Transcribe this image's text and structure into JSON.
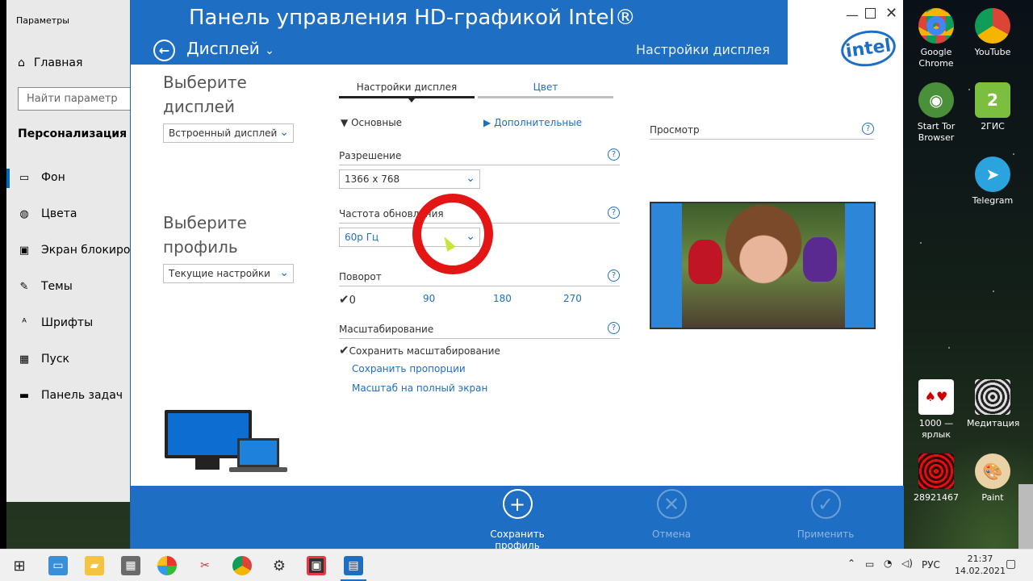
{
  "settings": {
    "title": "Параметры",
    "home": "Главная",
    "search_placeholder": "Найти параметр",
    "category": "Персонализация",
    "items": [
      "Фон",
      "Цвета",
      "Экран блокировки",
      "Темы",
      "Шрифты",
      "Пуск",
      "Панель задач"
    ]
  },
  "intel": {
    "app_title": "Панель управления HD-графикой Intel®",
    "section": "Дисплей",
    "header_sub": "Настройки дисплея",
    "logo": "intel",
    "choose_display": [
      "Выберите",
      "дисплей"
    ],
    "display_value": "Встроенный дисплей",
    "choose_profile": [
      "Выберите",
      "профиль"
    ],
    "profile_value": "Текущие настройки",
    "tabs": [
      "Настройки дисплея",
      "Цвет"
    ],
    "basic": "Основные",
    "advanced": "Дополнительные",
    "resolution_label": "Разрешение",
    "resolution_value": "1366 x 768",
    "refresh_label": "Частота обновления",
    "refresh_value": "60p Гц",
    "rotation_label": "Поворот",
    "rotation": [
      "0",
      "90",
      "180",
      "270"
    ],
    "rotation_selected": "0",
    "scaling_label": "Масштабирование",
    "scaling_options": [
      "Сохранить масштабирование",
      "Сохранить пропорции",
      "Масштаб на полный экран"
    ],
    "preview_label": "Просмотр",
    "help": "?",
    "footer": {
      "save_profile": "Сохранить профиль",
      "cancel": "Отмена",
      "apply": "Применить"
    }
  },
  "desktop_icons": [
    {
      "label": "Google Chrome",
      "icon": "chrome-icon"
    },
    {
      "label": "YouTube",
      "icon": "youtube-chrome-icon"
    },
    {
      "label": "Start Tor Browser",
      "icon": "tor-icon"
    },
    {
      "label": "2ГИС",
      "icon": "2gis-icon"
    },
    {
      "label": "Telegram",
      "icon": "telegram-icon"
    },
    {
      "label": "1000 — ярлык",
      "icon": "cards-icon"
    },
    {
      "label": "Медитация",
      "icon": "meditation-icon"
    },
    {
      "label": "28921467",
      "icon": "spiral-icon"
    },
    {
      "label": "Paint",
      "icon": "paint-icon"
    }
  ],
  "taskbar": {
    "language": "РУС",
    "time": "21:37",
    "date": "14.02.2021"
  },
  "colors": {
    "intel_blue": "#1e6fc3",
    "link_blue": "#1e6fc3",
    "annotation_red": "#e31515"
  }
}
